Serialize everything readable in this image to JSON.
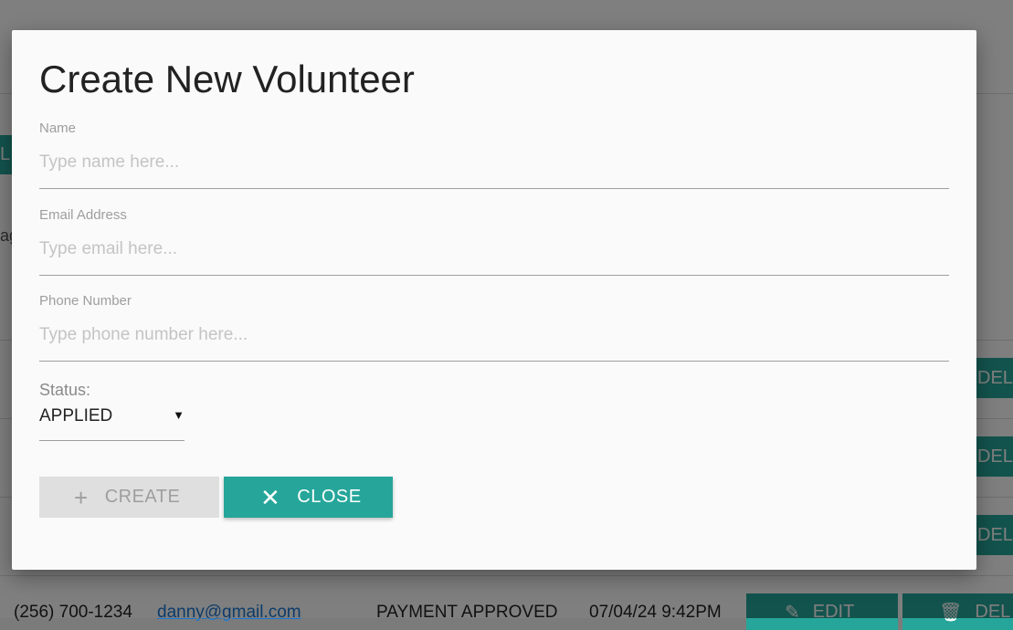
{
  "modal": {
    "title": "Create New Volunteer",
    "fields": [
      {
        "label": "Name",
        "placeholder": "Type name here...",
        "value": ""
      },
      {
        "label": "Email Address",
        "placeholder": "Type email here...",
        "value": ""
      },
      {
        "label": "Phone Number",
        "placeholder": "Type phone number here...",
        "value": ""
      }
    ],
    "status": {
      "label": "Status:",
      "value": "APPLIED"
    },
    "buttons": {
      "create": {
        "label": "CREATE",
        "icon": "plus-icon",
        "enabled": false
      },
      "close": {
        "label": "CLOSE",
        "icon": "close-icon"
      }
    }
  },
  "background": {
    "left_fragments": [
      "L",
      "ag"
    ],
    "row_delete_fragment": "DEL",
    "last_row": {
      "phone": "(256) 700-1234",
      "email": "danny@gmail.com",
      "status": "PAYMENT APPROVED",
      "datetime": "07/04/24 9:42PM",
      "edit_label": "EDIT",
      "delete_label": "DEL"
    }
  },
  "colors": {
    "accent": "#26a69a",
    "overlay": "rgba(0,0,0,0.5)"
  }
}
